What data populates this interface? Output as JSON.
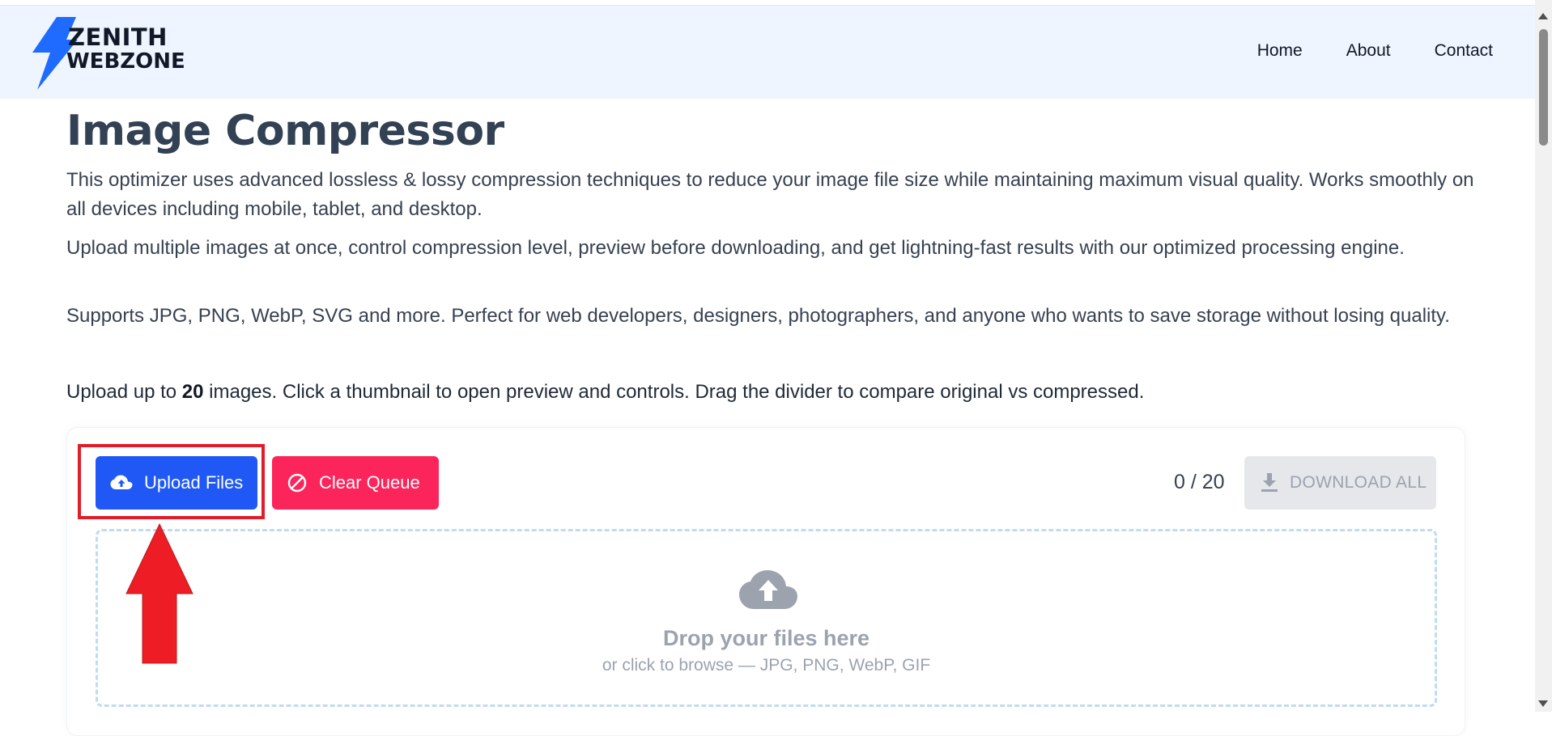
{
  "brand": {
    "line1": "ZENITH",
    "line2": "WEBZONE",
    "accent": "#1f6bff"
  },
  "nav": {
    "items": [
      "Home",
      "About",
      "Contact"
    ]
  },
  "page": {
    "title": "Image Compressor",
    "para1": "This optimizer uses advanced lossless & lossy compression techniques to reduce your image file size while maintaining maximum visual quality. Works smoothly on all devices including mobile, tablet, and desktop.",
    "para2": "Upload multiple images at once, control compression level, preview before downloading, and get lightning-fast results with our optimized processing engine.",
    "para3": "Supports JPG, PNG, WebP, SVG and more. Perfect for web developers, designers, photographers, and anyone who wants to save storage without losing quality.",
    "instr_prefix": "Upload up to ",
    "instr_limit": "20",
    "instr_suffix": " images. Click a thumbnail to open preview and controls. Drag the divider to compare original vs compressed."
  },
  "toolbar": {
    "upload_label": "Upload Files",
    "clear_label": "Clear Queue",
    "counter": "0 / 20",
    "download_label": "DOWNLOAD ALL",
    "upload_color": "#1f58f5",
    "clear_color": "#fb255c"
  },
  "dropzone": {
    "title": "Drop your files here",
    "subtitle": "or click to browse — JPG, PNG, WebP, GIF",
    "icon": "cloud-upload-icon"
  },
  "annotation": {
    "highlight_color": "#e11d2a",
    "arrow_icon": "up-arrow-icon"
  }
}
